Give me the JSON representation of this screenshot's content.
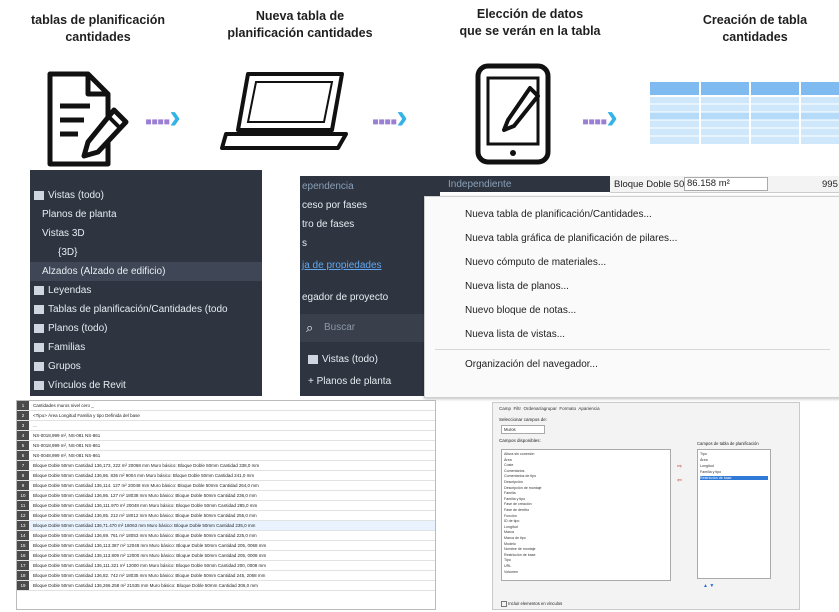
{
  "steps": [
    {
      "title_line1": "tablas de planificación",
      "title_line2": "cantidades"
    },
    {
      "title_line1": "Nueva tabla de",
      "title_line2": "planificación cantidades"
    },
    {
      "title_line1": "Elección de datos",
      "title_line2": "que se verán en la tabla"
    },
    {
      "title_line1": "Creación de tabla",
      "title_line2": "cantidades"
    }
  ],
  "browser": {
    "items": [
      {
        "label": "Vistas (todo)"
      },
      {
        "label": "Planos de planta"
      },
      {
        "label": "Vistas 3D"
      },
      {
        "label": "{3D}"
      },
      {
        "label": "Alzados (Alzado de edificio)"
      },
      {
        "label": "Leyendas"
      },
      {
        "label": "Tablas de planificación/Cantidades (todo"
      },
      {
        "label": "Planos (todo)"
      },
      {
        "label": "Familias"
      },
      {
        "label": "Grupos"
      },
      {
        "label": "Vínculos de Revit"
      }
    ]
  },
  "context": {
    "header": {
      "col1": "ependencia",
      "col2": "Independiente",
      "bloque": "Bloque Doble 50m",
      "area": "86.158 m²",
      "trail": "995"
    },
    "left_items": [
      "ceso por fases",
      "tro de fases",
      "s",
      "ja de propiedades",
      "egador de proyecto"
    ],
    "search_placeholder": "Buscar",
    "tree_items": [
      "Vistas (todo)",
      "Planos de planta"
    ],
    "menu_items": [
      "Nueva tabla de planificación/Cantidades...",
      "Nueva tabla gráfica de planificación de pilares...",
      "Nuevo cómputo de materiales...",
      "Nueva lista de planos...",
      "Nuevo bloque de notas...",
      "Nueva lista de vistas...",
      "Organización del navegador..."
    ]
  },
  "sheet": {
    "rows": [
      "Cantidades muros nivel cero _",
      "<Tipo> Área Longitud Familia y tipo Definida del base",
      "...",
      "NS-0018,999 m², NS-081 NS-861",
      "NS-0018,999 m², NS-081 NS-861",
      "NS-0048,999 m², NS-081 NS-861",
      "Bloque Doble 50mm Cantidad 136,173, 222 m² 20068 mm Muro básico: Bloque Doble 50mm Cantidad 338,0 mm",
      "Bloque Doble 50mm Cantidad 136,86. 836 m² 9004 mm Muro básico: Bloque Doble 50mm Cantidad 241,0 mm",
      "Bloque Doble 50mm Cantidad 136,114. 127 m² 20048 mm Muro básico: Bloque Doble 50mm Cantidad 264,0 mm",
      "Bloque Doble 50mm Cantidad 136,86. 127 m² 18038 mm Muro básico: Bloque Doble 50mm Cantidad 236,0 mm",
      "Bloque Doble 50mm Cantidad 136,111.970 m² 20048 mm Muro básico: Bloque Doble 50mm Cantidad 285,0 mm",
      "Bloque Doble 50mm Cantidad 136,85. 212 m² 18012 mm Muro básico: Bloque Doble 50mm Cantidad 255,0 mm",
      "Bloque Doble 50mm Cantidad 136,71.470 m² 18063 mm Muro básico: Bloque Doble 50mm Cantidad 235,0 mm",
      "Bloque Doble 50mm Cantidad 136,69. 761 m² 18053 mm Muro básico: Bloque Doble 50mm Cantidad 225,0 mm",
      "Bloque Doble 50mm Cantidad 136,113.387 m² 12048 mm Muro básico: Bloque Doble 50mm Cantidad 205, 0068 mm",
      "Bloque Doble 50mm Cantidad 136,113.809 m² 12000 mm Muro básico: Bloque Doble 50mm Cantidad 205, 0008 mm",
      "Bloque Doble 50mm Cantidad 136,111.321 m² 12000 mm Muro básico: Bloque Doble 50mm Cantidad 200, 0008 mm",
      "Bloque Doble 50mm Cantidad 136,82. 742 m² 18035 mm Muro básico: Bloque Doble 50mm Cantidad 245, 2068 mm",
      "Bloque Doble 50mm Cantidad 136,266.258 m² 21535 mm Muro básico: Bloque Doble 50mm Cantidad 306,0 mm"
    ]
  },
  "dialog": {
    "menu": [
      "Camp",
      "Filtr",
      "Ordenar/agrupar",
      "Formato",
      "Apariencia"
    ],
    "section1": "Seleccionar campos de:",
    "combo": "Muros",
    "section2": "Campos disponibles:",
    "left_list": [
      "Altura sin conexión",
      "Área",
      "Coste",
      "Comentarios",
      "Comentarios de tipo",
      "Descripción",
      "Descripción de montaje",
      "Familia",
      "Familia y tipo",
      "Fase de creación",
      "Fase de derribo",
      "Función",
      "ID de tipo",
      "Longitud",
      "Marca",
      "Marca de tipo",
      "Modelo",
      "Nombre de montaje",
      "Restricción de base",
      "Tipo",
      "URL",
      "Volumen"
    ],
    "right_title": "Campos de tabla de planificación",
    "right_list": [
      "Tipo",
      "Área",
      "Longitud",
      "Familia y tipo",
      "Restricción de base"
    ],
    "checkbox": "Incluir elementos en vínculos"
  },
  "colors": {
    "arrow_dots": "#9b7fd4",
    "arrow_chevron": "#36b3e6",
    "panel_dark": "#2e3440",
    "table_blue": "#8ec5ef"
  }
}
